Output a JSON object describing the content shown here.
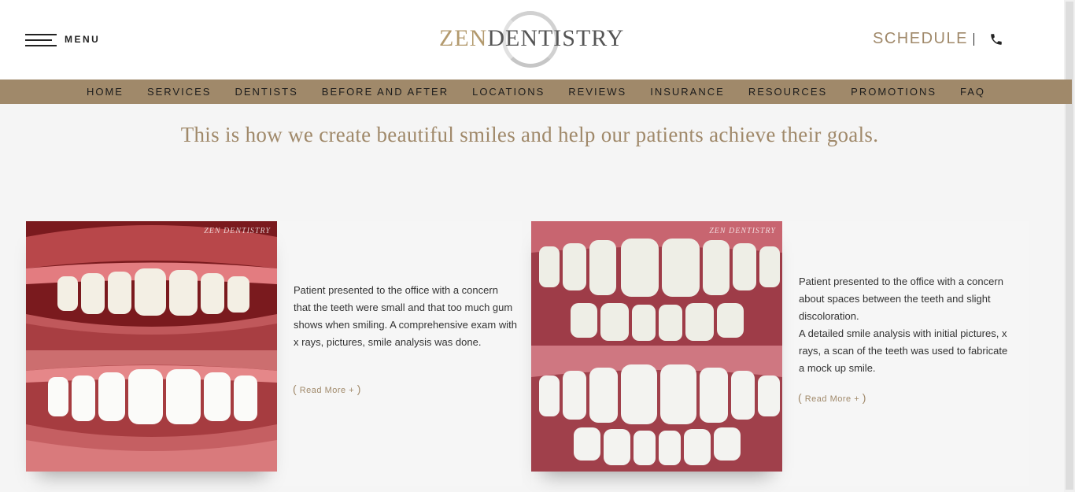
{
  "header": {
    "menu_label": "MENU",
    "logo_part1": "ZEN",
    "logo_part2": "DENTISTRY",
    "schedule_label": "SCHEDULE",
    "accent_color": "#a0896a"
  },
  "nav": {
    "items": [
      "HOME",
      "SERVICES",
      "DENTISTS",
      "BEFORE AND AFTER",
      "LOCATIONS",
      "REVIEWS",
      "INSURANCE",
      "RESOURCES",
      "PROMOTIONS",
      "FAQ"
    ]
  },
  "main": {
    "headline": "This is how we create beautiful smiles and help our patients achieve their goals.",
    "cards": [
      {
        "watermark": "ZEN DENTISTRY",
        "description_lines": [
          "Patient presented to the office with a concern that the teeth were small and that too much gum shows when smiling. A comprehensive exam with x rays, pictures, smile analysis was done."
        ],
        "read_more": "Read More +"
      },
      {
        "watermark": "ZEN DENTISTRY",
        "description_lines": [
          "Patient presented to the office with a concern about spaces between the teeth and slight discoloration.",
          "A detailed smile analysis with initial pictures, x rays, a scan of the teeth was used to fabricate a mock up smile."
        ],
        "read_more": "Read More +"
      }
    ]
  }
}
